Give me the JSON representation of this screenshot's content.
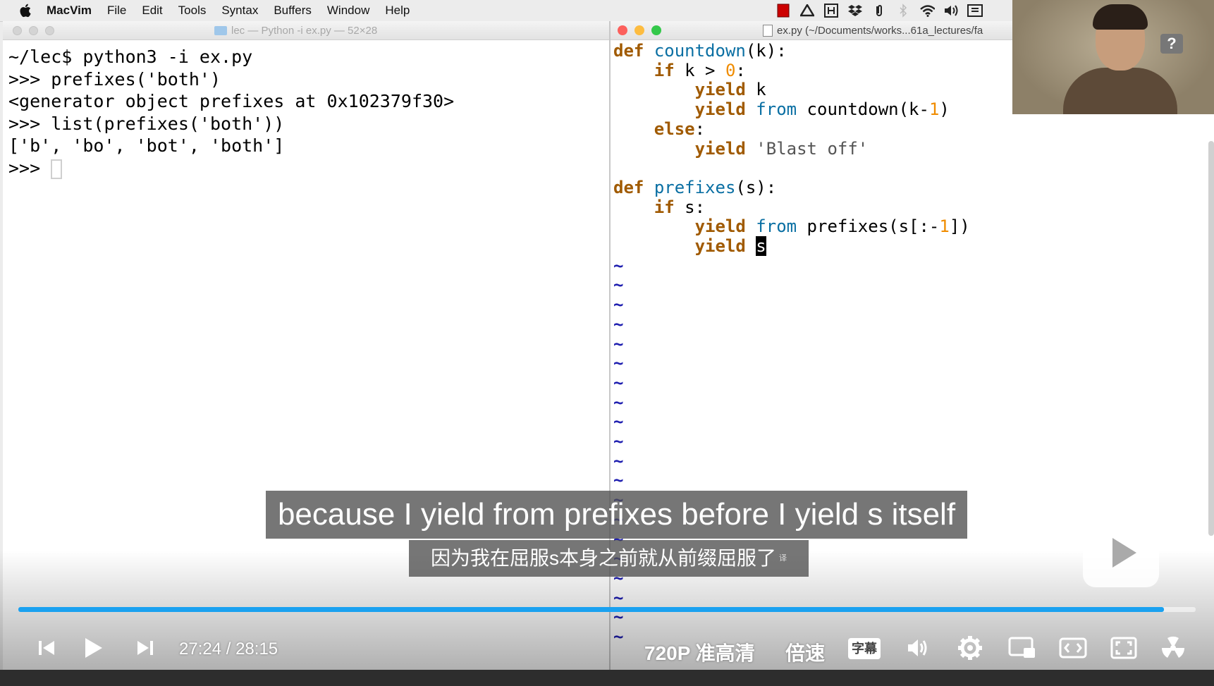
{
  "menubar": {
    "app": "MacVim",
    "items": [
      "File",
      "Edit",
      "Tools",
      "Syntax",
      "Buffers",
      "Window",
      "Help"
    ]
  },
  "terminal": {
    "title": "lec — Python -i ex.py — 52×28",
    "lines": [
      "~/lec$ python3 -i ex.py",
      ">>> prefixes('both')",
      "<generator object prefixes at 0x102379f30>",
      ">>> list(prefixes('both'))",
      "['b', 'bo', 'bot', 'both']"
    ],
    "prompt": ">>> "
  },
  "vim": {
    "title": "ex.py (~/Documents/works...61a_lectures/fa",
    "code_lines": [
      "def countdown(k):",
      "    if k > 0:",
      "        yield k",
      "        yield from countdown(k-1)",
      "    else:",
      "        yield 'Blast off'",
      "",
      "def prefixes(s):",
      "    if s:",
      "        yield from prefixes(s[:-1])",
      "        yield s"
    ],
    "tilde_count": 20
  },
  "webcam": {
    "help_label": "?"
  },
  "subtitles": {
    "english": "because I yield from prefixes before I yield s itself",
    "chinese": "因为我在屈服s本身之前就从前缀屈服了",
    "translate_mark": "译"
  },
  "player": {
    "current_time": "27:24",
    "separator": "/",
    "total_time": "28:15",
    "progress_fraction": 0.973,
    "quality_label": "720P 准高清",
    "speed_label": "倍速",
    "subtitle_label": "字幕",
    "accent_color": "#1aa1f0"
  },
  "icons": {
    "prev": "skip-previous-icon",
    "play": "play-icon",
    "next": "skip-next-icon",
    "volume": "volume-icon",
    "settings": "gear-icon",
    "pip": "picture-in-picture-icon",
    "widescreen": "widescreen-icon",
    "fullscreen": "fullscreen-icon"
  }
}
